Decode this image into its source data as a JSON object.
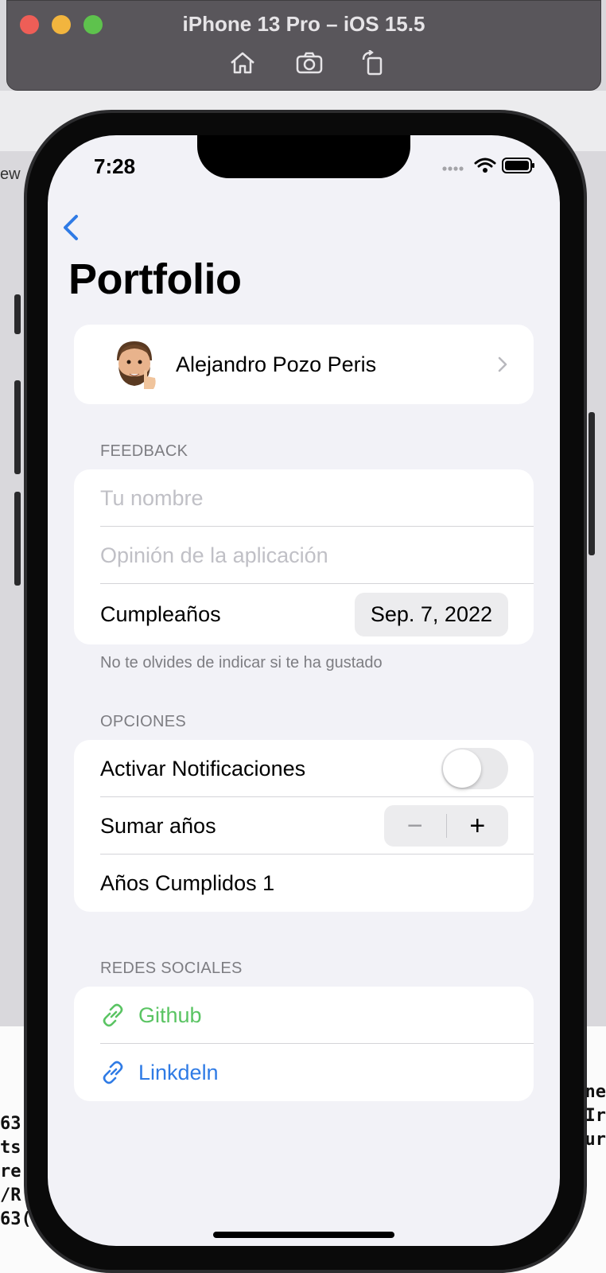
{
  "simulator": {
    "title": "iPhone 13 Pro – iOS 15.5",
    "toolbar_icons": [
      "home-icon",
      "screenshot-icon",
      "rotate-icon"
    ]
  },
  "background": {
    "left_code": [
      "63",
      "ts",
      "re",
      "/R",
      "63("
    ],
    "right_code": [
      "ne",
      "",
      "",
      ":Ir",
      "ur"
    ],
    "side_text": "ew"
  },
  "status_bar": {
    "time": "7:28",
    "icons": [
      "signal-dots-icon",
      "wifi-icon",
      "battery-icon"
    ]
  },
  "nav": {
    "back_icon": "chevron-left-icon",
    "title": "Portfolio"
  },
  "profile": {
    "name": "Alejandro Pozo Peris"
  },
  "feedback": {
    "header": "FEEDBACK",
    "name_placeholder": "Tu nombre",
    "opinion_placeholder": "Opinión de la aplicación",
    "birthday_label": "Cumpleaños",
    "birthday_value": "Sep. 7, 2022",
    "footer": "No te olvides de indicar si te ha gustado"
  },
  "options": {
    "header": "OPCIONES",
    "notifications_label": "Activar Notificaciones",
    "notifications_on": false,
    "add_years_label": "Sumar años",
    "stepper_minus": "−",
    "stepper_plus": "+",
    "years_text": "Años Cumplidos 1"
  },
  "social": {
    "header": "REDES SOCIALES",
    "links": [
      {
        "label": "Github",
        "color": "#5ac463"
      },
      {
        "label": "Linkdeln",
        "color": "#2f7be5"
      }
    ]
  },
  "colors": {
    "accent": "#2f7be5",
    "github": "#5ac463",
    "background": "#f2f2f7"
  }
}
